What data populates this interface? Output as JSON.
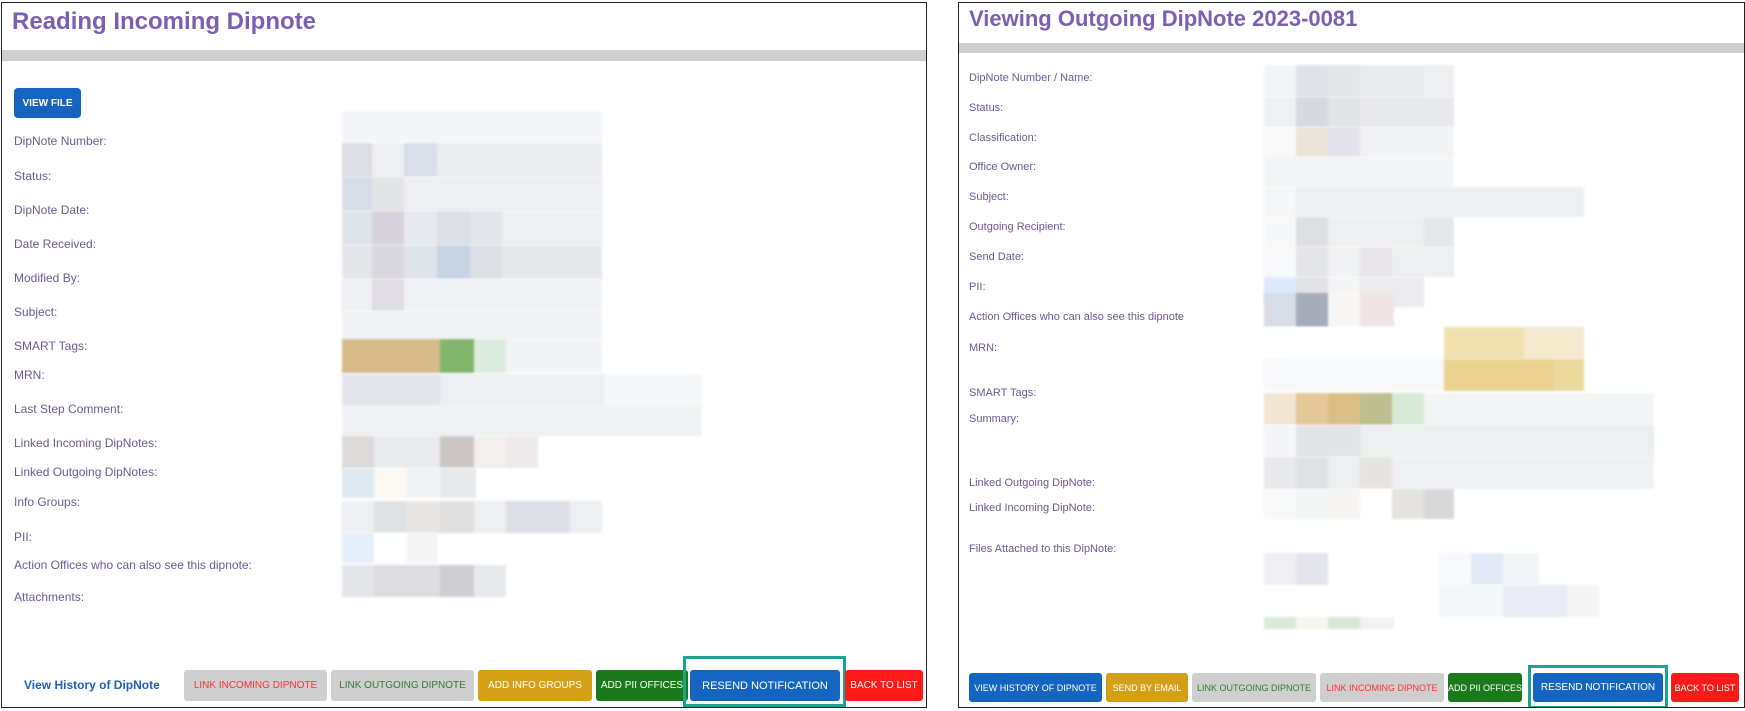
{
  "left": {
    "title": "Reading Incoming Dipnote",
    "view_file": "VIEW FILE",
    "labels": [
      "DipNote Number:",
      "Status:",
      "DipNote Date:",
      "Date Received:",
      "Modified By:",
      "Subject:",
      "SMART Tags:",
      "MRN:",
      "Last Step Comment:",
      "Linked Incoming DipNotes:",
      "Linked Outgoing DipNotes:",
      "Info Groups:",
      "PII:",
      "Action Offices who can also see this dipnote:",
      "Attachments:"
    ],
    "history_link": "View History of DipNote",
    "buttons": {
      "link_incoming": "LINK INCOMING DIPNOTE",
      "link_outgoing": "LINK OUTGOING DIPNOTE",
      "add_info_groups": "ADD INFO GROUPS",
      "add_pii_offices": "ADD PII OFFICES",
      "resend_notification": "RESEND NOTIFICATION",
      "back_to_list": "BACK TO LIST"
    }
  },
  "right": {
    "title": "Viewing Outgoing DipNote 2023-0081",
    "labels": [
      "DipNote Number / Name:",
      "Status:",
      "Classification:",
      "Office Owner:",
      "Subject:",
      "Outgoing Recipient:",
      "Send Date:",
      "PII:",
      "Action Offices who can also see this dipnote",
      "MRN:",
      "SMART Tags:",
      "Summary:",
      "Linked Outgoing DipNote:",
      "Linked Incoming DipNote:",
      "Files Attached to this DipNote:"
    ],
    "buttons": {
      "view_history": "VIEW HISTORY OF DIPNOTE",
      "send_by_email": "SEND BY EMAIL",
      "link_outgoing": "LINK OUTGOING DIPNOTE",
      "link_incoming": "LINK INCOMING DIPNOTE",
      "add_pii_offices": "ADD PII OFFICES",
      "resend_notification": "RESEND NOTIFICATION",
      "back_to_list": "BACK TO LIST"
    }
  },
  "colors": {
    "title": "#7b5fb0",
    "label": "#6c5a96",
    "primary": "#1565c0",
    "gray_button": "#cfcfcf",
    "yellow_button": "#d4a017",
    "green_button": "#1a7a1a",
    "red_button": "#ff1a1a",
    "highlight": "#1aa38f"
  }
}
